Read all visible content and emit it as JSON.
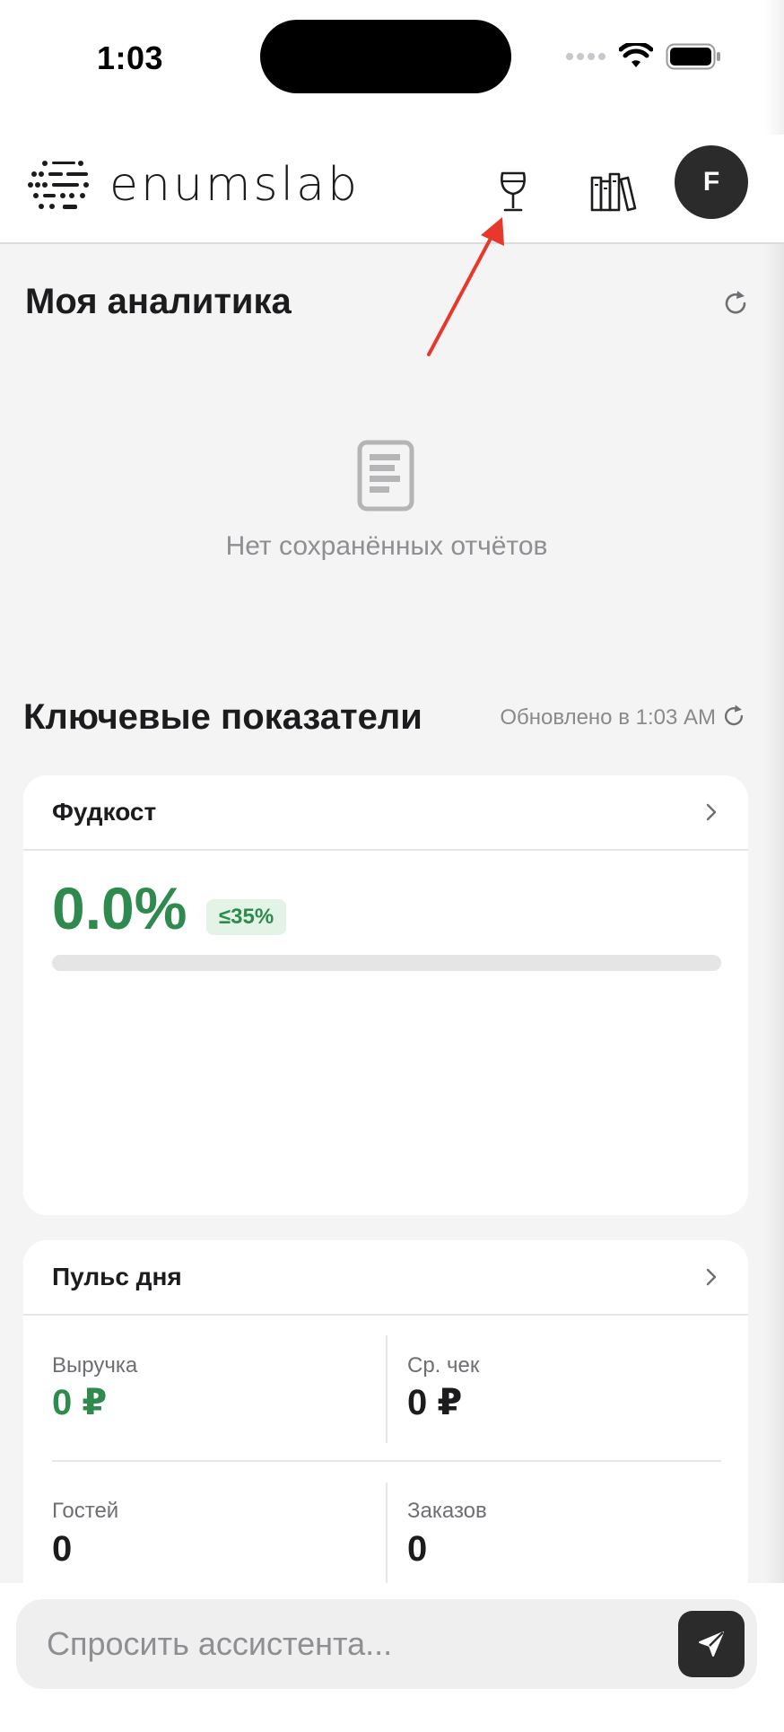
{
  "status_bar": {
    "time": "1:03"
  },
  "header": {
    "brand": "enumslab",
    "avatar_initial": "F"
  },
  "analytics": {
    "title": "Моя аналитика",
    "empty_text": "Нет сохранённых отчётов"
  },
  "kpi": {
    "title": "Ключевые показатели",
    "updated": "Обновлено в 1:03 AM"
  },
  "foodcost": {
    "title": "Фудкост",
    "value": "0.0%",
    "badge": "≤35%",
    "progress_fraction": 0.0
  },
  "pulse": {
    "title": "Пульс дня",
    "revenue_label": "Выручка",
    "revenue_value": "0 ₽",
    "avg_check_label": "Ср. чек",
    "avg_check_value": "0 ₽",
    "guests_label": "Гостей",
    "guests_value": "0",
    "orders_label": "Заказов",
    "orders_value": "0"
  },
  "assistant": {
    "placeholder": "Спросить ассистента..."
  },
  "icons": {
    "wine": "wine-glass-icon",
    "library": "books-icon",
    "refresh": "refresh-icon",
    "report": "document-icon",
    "chevron": "chevron-right-icon",
    "send": "send-icon"
  },
  "colors": {
    "accent_green": "#2f8a4e",
    "arrow_red": "#e8382c",
    "dark": "#2b2b2b"
  }
}
